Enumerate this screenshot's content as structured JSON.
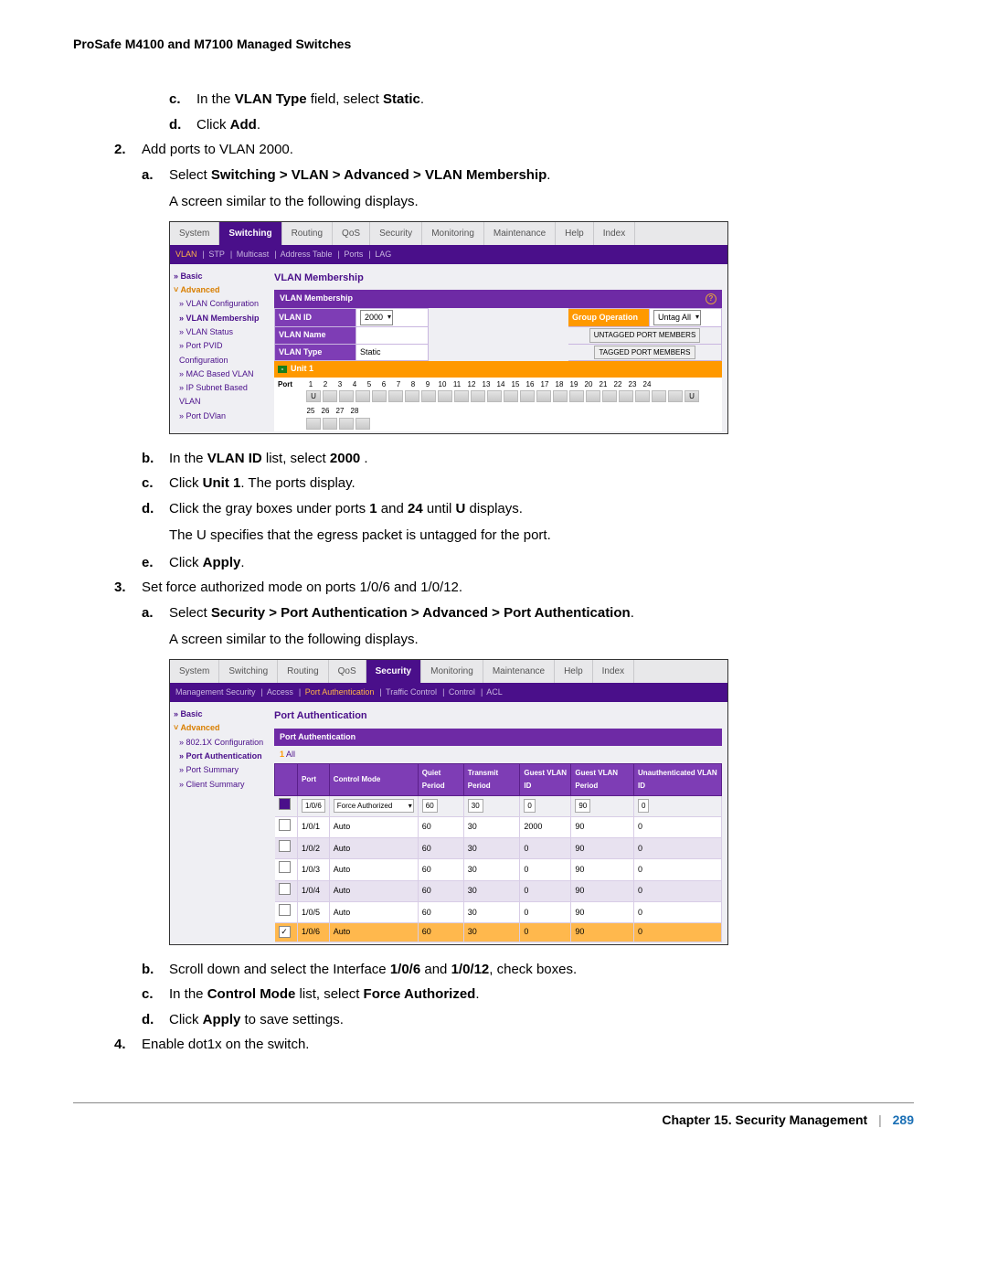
{
  "header": "ProSafe M4100 and M7100 Managed Switches",
  "footer": {
    "chapter": "Chapter 15.  Security Management",
    "page": "289"
  },
  "txt": {
    "c1a": "In the ",
    "c1b": "VLAN Type",
    "c1c": " field, select ",
    "c1d": "Static",
    "c1e": ".",
    "d1a": "Click ",
    "d1b": "Add",
    "d1c": ".",
    "s2": "Add ports to VLAN 2000.",
    "a2a": "Select ",
    "a2b": "Switching > VLAN > Advanced > VLAN Membership",
    "a2c": ".",
    "a2d": "A screen similar to the following displays.",
    "b2a": "In the ",
    "b2b": "VLAN ID",
    "b2c": " list, select ",
    "b2d": "2000",
    "b2e": " .",
    "c2a": "Click ",
    "c2b": "Unit 1",
    "c2c": ". The ports display.",
    "d2a": "Click the gray boxes under ports ",
    "d2b": "1",
    "d2c": " and ",
    "d2d": "24",
    "d2e": " until ",
    "d2f": "U",
    "d2g": " displays.",
    "d2h": "The U specifies that the egress packet is untagged for the port.",
    "e2a": "Click ",
    "e2b": "Apply",
    "e2c": ".",
    "s3": "Set force authorized mode on ports 1/0/6 and 1/0/12.",
    "a3a": "Select ",
    "a3b": "Security > Port Authentication > Advanced > Port Authentication",
    "a3c": ".",
    "a3d": "A screen similar to the following displays.",
    "b3a": "Scroll down and select the Interface ",
    "b3b": "1/0/6",
    "b3c": " and ",
    "b3d": "1/0/12",
    "b3e": ", check boxes.",
    "c3a": "In the ",
    "c3b": "Control Mode",
    "c3c": " list, select ",
    "c3d": "Force Authorized",
    "c3e": ".",
    "d3a": "Click ",
    "d3b": "Apply",
    "d3c": " to save settings.",
    "s4": "Enable dot1x on the switch."
  },
  "shot1": {
    "tabs": [
      "System",
      "Switching",
      "Routing",
      "QoS",
      "Security",
      "Monitoring",
      "Maintenance",
      "Help",
      "Index"
    ],
    "subnav": [
      "VLAN",
      "STP",
      "Multicast",
      "Address Table",
      "Ports",
      "LAG"
    ],
    "leftnav": {
      "basic": "Basic",
      "advanced": "Advanced",
      "items": [
        "VLAN Configuration",
        "VLAN Membership",
        "VLAN Status",
        "Port PVID Configuration",
        "MAC Based VLAN",
        "IP Subnet Based VLAN",
        "Port DVlan"
      ]
    },
    "title": "VLAN Membership",
    "stripe": "VLAN Membership",
    "form": {
      "vlan_id_label": "VLAN ID",
      "vlan_id_value": "2000",
      "vlan_name_label": "VLAN Name",
      "vlan_name_value": "",
      "vlan_type_label": "VLAN Type",
      "vlan_type_value": "Static",
      "group_op_label": "Group Operation",
      "group_op_value": "Untag All",
      "untagged_btn": "UNTAGGED PORT MEMBERS",
      "tagged_btn": "TAGGED PORT MEMBERS"
    },
    "unit": "Unit 1",
    "port_label": "Port",
    "ports_row1": [
      "1",
      "2",
      "3",
      "4",
      "5",
      "6",
      "7",
      "8",
      "9",
      "10",
      "11",
      "12",
      "13",
      "14",
      "15",
      "16",
      "17",
      "18",
      "19",
      "20",
      "21",
      "22",
      "23",
      "24"
    ],
    "ports_row2": [
      "25",
      "26",
      "27",
      "28"
    ]
  },
  "shot2": {
    "tabs": [
      "System",
      "Switching",
      "Routing",
      "QoS",
      "Security",
      "Monitoring",
      "Maintenance",
      "Help",
      "Index"
    ],
    "subnav": [
      "Management Security",
      "Access",
      "Port Authentication",
      "Traffic Control",
      "Control",
      "ACL"
    ],
    "leftnav": {
      "basic": "Basic",
      "advanced": "Advanced",
      "items": [
        "802.1X Configuration",
        "Port Authentication",
        "Port Summary",
        "Client Summary"
      ]
    },
    "title": "Port Authentication",
    "stripe": "Port Authentication",
    "sub": {
      "one": "1",
      "all": "All"
    },
    "cols": [
      "",
      "Port",
      "Control Mode",
      "Quiet Period",
      "Transmit Period",
      "Guest VLAN ID",
      "Guest VLAN Period",
      "Unauthenticated VLAN ID"
    ],
    "editrow": {
      "port": "1/0/6",
      "mode": "Force Authorized",
      "quiet": "60",
      "trans": "30",
      "gvid": "0",
      "gvp": "90",
      "uvid": "0"
    },
    "rows": [
      {
        "port": "1/0/1",
        "mode": "Auto",
        "quiet": "60",
        "trans": "30",
        "gvid": "2000",
        "gvp": "90",
        "uvid": "0",
        "cls": "norm"
      },
      {
        "port": "1/0/2",
        "mode": "Auto",
        "quiet": "60",
        "trans": "30",
        "gvid": "0",
        "gvp": "90",
        "uvid": "0",
        "cls": "alt"
      },
      {
        "port": "1/0/3",
        "mode": "Auto",
        "quiet": "60",
        "trans": "30",
        "gvid": "0",
        "gvp": "90",
        "uvid": "0",
        "cls": "norm"
      },
      {
        "port": "1/0/4",
        "mode": "Auto",
        "quiet": "60",
        "trans": "30",
        "gvid": "0",
        "gvp": "90",
        "uvid": "0",
        "cls": "alt"
      },
      {
        "port": "1/0/5",
        "mode": "Auto",
        "quiet": "60",
        "trans": "30",
        "gvid": "0",
        "gvp": "90",
        "uvid": "0",
        "cls": "norm"
      },
      {
        "port": "1/0/6",
        "mode": "Auto",
        "quiet": "60",
        "trans": "30",
        "gvid": "0",
        "gvp": "90",
        "uvid": "0",
        "cls": "selrow",
        "checked": true
      }
    ]
  }
}
